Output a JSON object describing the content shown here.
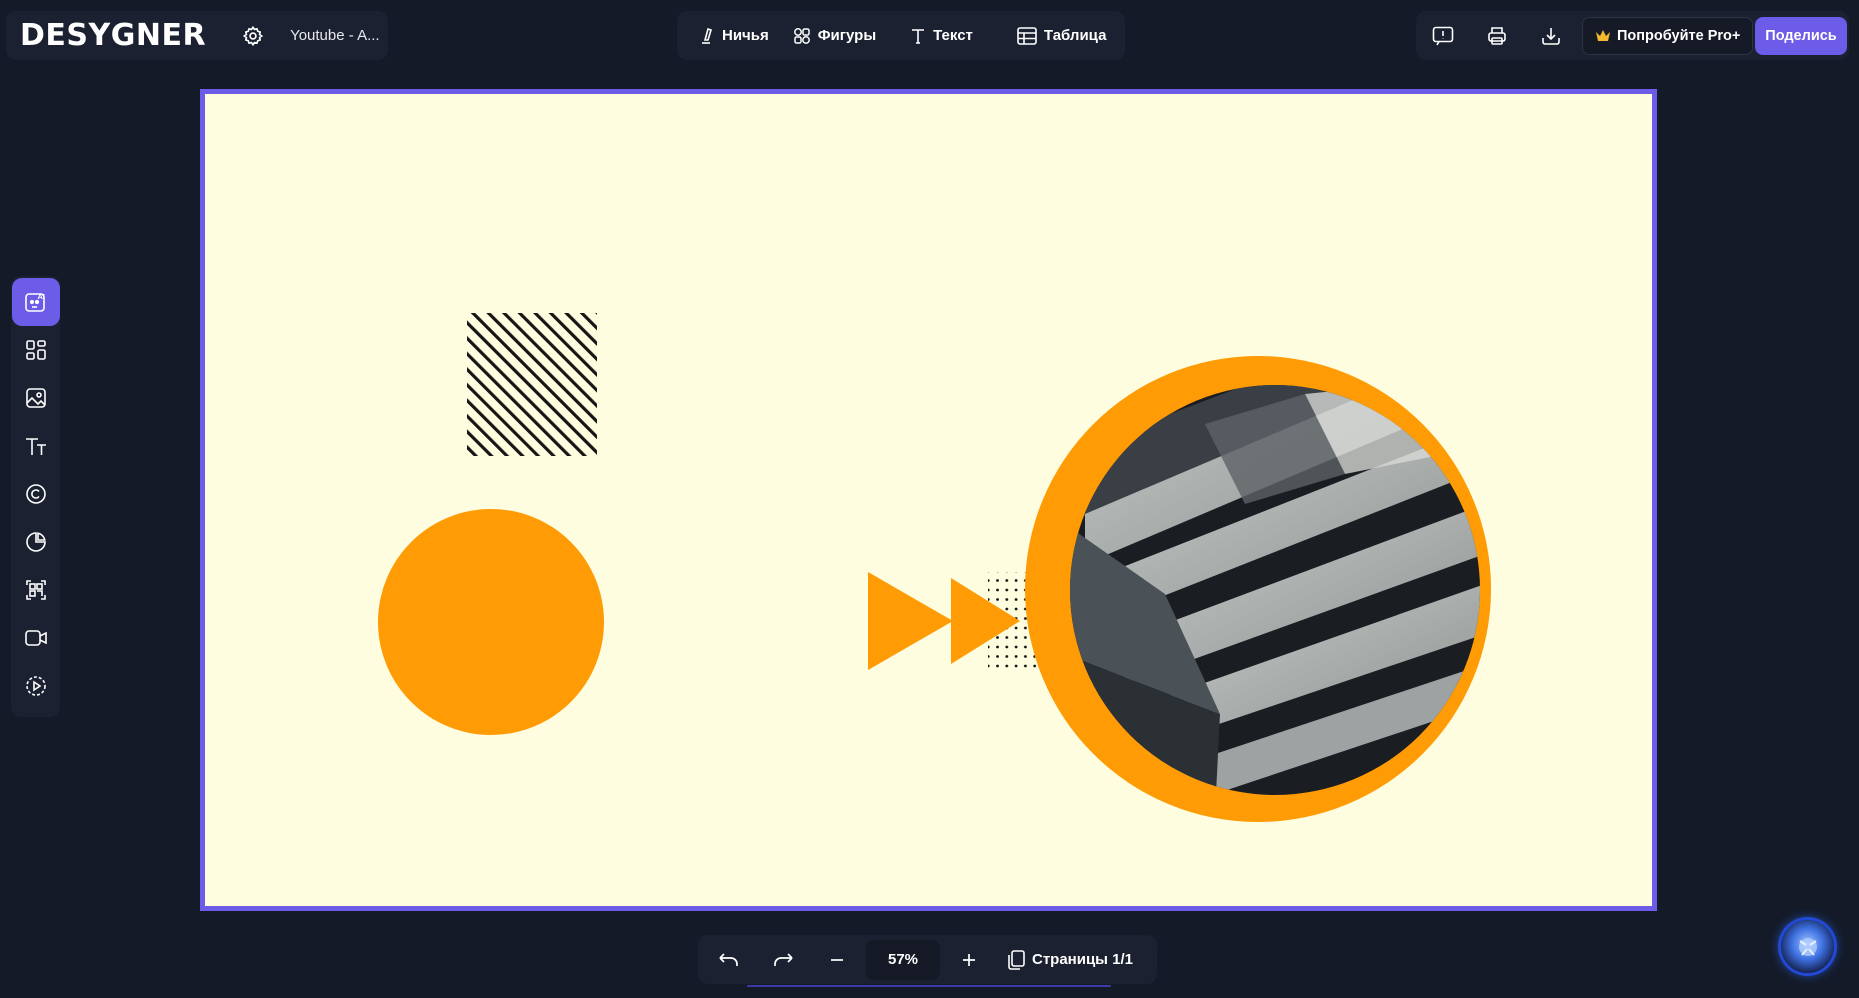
{
  "app": {
    "logo": "DESYGNER",
    "doc_title": "Youtube - A..."
  },
  "toolbar": {
    "items": [
      {
        "label": "Ничья",
        "icon": "pen-icon"
      },
      {
        "label": "Фигуры",
        "icon": "shapes-icon"
      },
      {
        "label": "Текст",
        "icon": "text-icon"
      },
      {
        "label": "Таблица",
        "icon": "table-icon"
      }
    ]
  },
  "actions": {
    "icons": [
      "feedback-icon",
      "print-icon",
      "download-icon"
    ],
    "pro_label": "Попробуйте Pro+",
    "share_label": "Поделись"
  },
  "sidebar": {
    "items": [
      "ai-icon",
      "templates-icon",
      "image-icon",
      "text-icon",
      "copyright-icon",
      "chart-icon",
      "qr-icon",
      "video-icon",
      "animation-icon"
    ],
    "active": "ai-icon"
  },
  "bottom": {
    "zoom": "57%",
    "pages_label": "Страницы 1/1"
  },
  "colors": {
    "accent": "#6c5ce7",
    "canvas_bg": "#fefddf",
    "orange": "#ff9b04",
    "app_bg": "#141a27",
    "panel_bg": "#1b2130"
  }
}
